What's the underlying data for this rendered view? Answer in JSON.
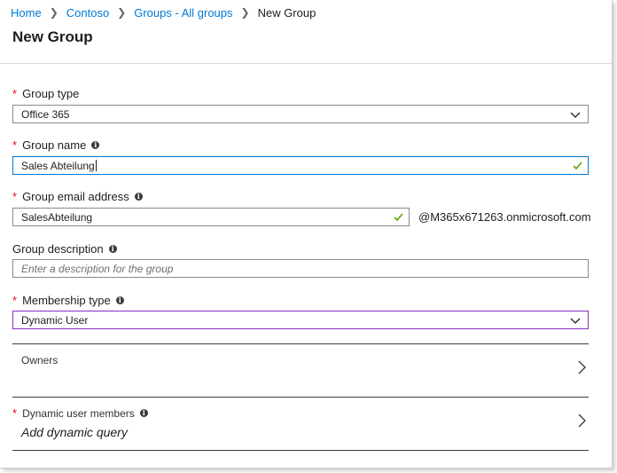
{
  "breadcrumb": {
    "items": [
      "Home",
      "Contoso",
      "Groups - All groups"
    ],
    "current": "New Group"
  },
  "page": {
    "title": "New Group"
  },
  "form": {
    "group_type": {
      "label": "Group type",
      "required": true,
      "value": "Office 365"
    },
    "group_name": {
      "label": "Group name",
      "required": true,
      "value": "Sales Abteilung",
      "valid": true
    },
    "group_email": {
      "label": "Group email address",
      "required": true,
      "value": "SalesAbteilung",
      "valid": true,
      "domain_suffix": "@M365x671263.onmicrosoft.com"
    },
    "group_description": {
      "label": "Group description",
      "required": false,
      "value": "",
      "placeholder": "Enter a description for the group"
    },
    "membership_type": {
      "label": "Membership type",
      "required": true,
      "value": "Dynamic User"
    }
  },
  "owners": {
    "label": "Owners"
  },
  "dynamic_members": {
    "label": "Dynamic user members",
    "required": true,
    "action": "Add dynamic query"
  },
  "icons": {
    "required_marker": "*",
    "info": "info-icon",
    "dropdown": "chevron-down-icon",
    "valid": "checkmark-icon",
    "navigate": "chevron-right-icon"
  },
  "colors": {
    "link": "#0078d4",
    "required": "#e00b1c",
    "valid_check": "#57a300",
    "focus_border": "#0078d4",
    "membership_border": "#8b2fbf"
  }
}
